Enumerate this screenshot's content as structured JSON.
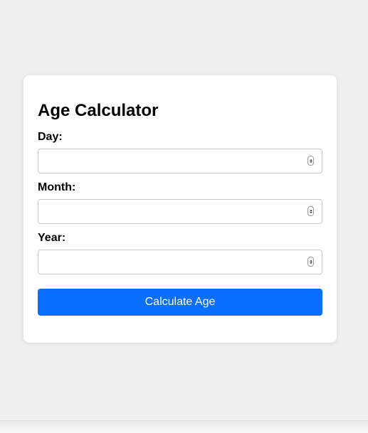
{
  "app": {
    "title": "Age Calculator"
  },
  "form": {
    "day": {
      "label": "Day:",
      "value": "",
      "placeholder": ""
    },
    "month": {
      "label": "Month:",
      "value": "",
      "placeholder": ""
    },
    "year": {
      "label": "Year:",
      "value": "",
      "placeholder": ""
    },
    "submit_label": "Calculate Age"
  },
  "icons": {
    "spinner": "number-spinner-icon"
  },
  "colors": {
    "page_background": "#efefef",
    "card_background": "#ffffff",
    "button_background": "#0a6fff",
    "button_text": "#ffffff",
    "input_border": "#c8c8c8"
  }
}
